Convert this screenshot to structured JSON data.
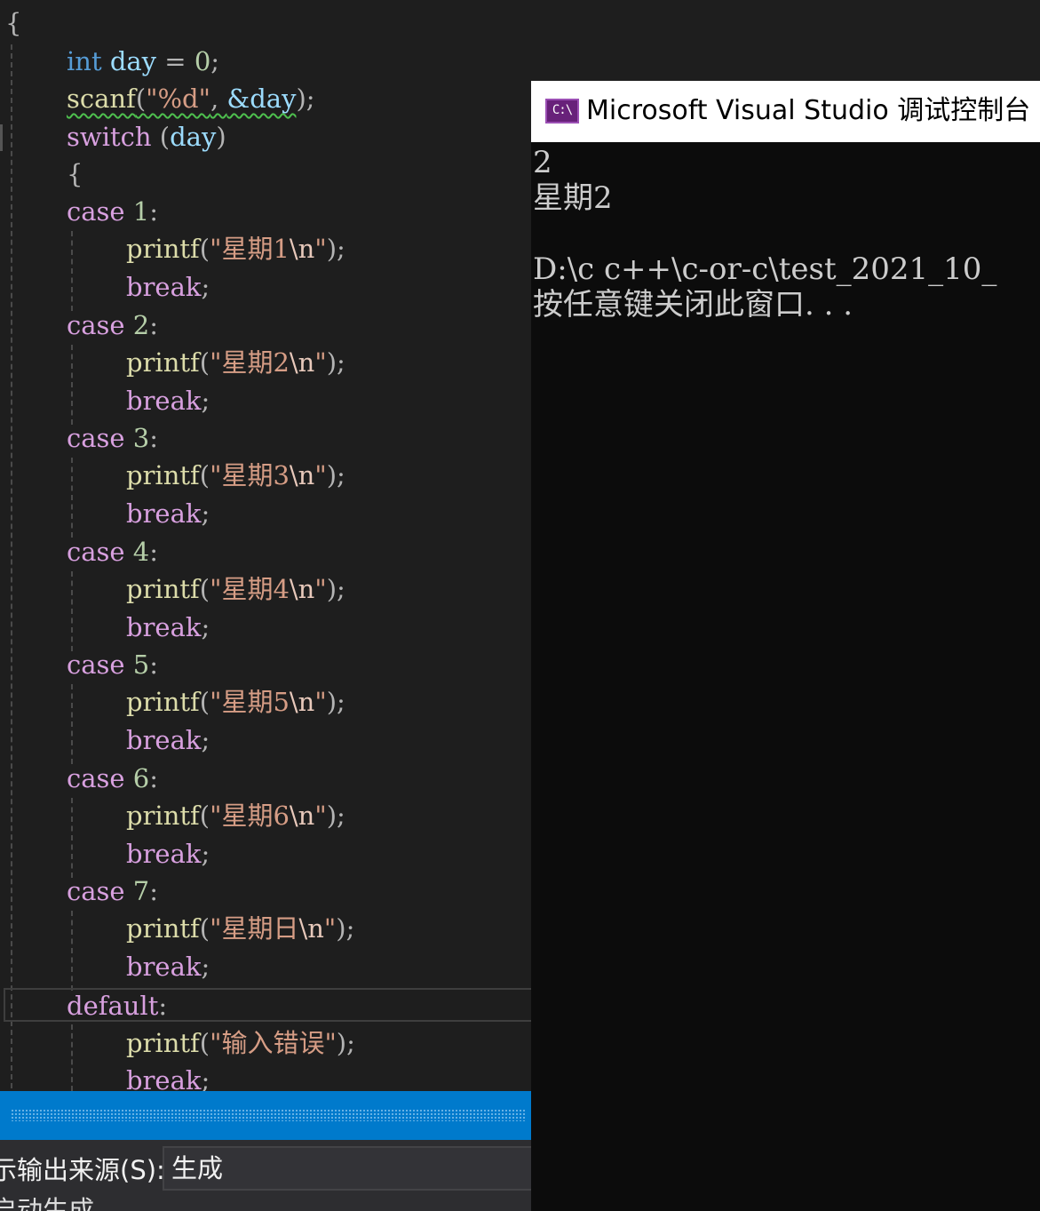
{
  "editor": {
    "open_brace": "{",
    "lines": {
      "decl": {
        "type": "int",
        "name": "day",
        "op": " = ",
        "value": "0",
        "end": ";"
      },
      "scanf": {
        "fn": "scanf",
        "open": "(",
        "fmt": "\"%d\"",
        "sep": ", ",
        "arg": "&day",
        "close": ");"
      },
      "switch": {
        "kw": "switch",
        "open": " (",
        "var": "day",
        "close": ")"
      },
      "brace": "{",
      "cases": [
        {
          "kw": "case",
          "num": "1",
          "colon": ":",
          "str_pre": "\"星期1",
          "esc": "\\n",
          "str_post": "\"",
          "brk": "break"
        },
        {
          "kw": "case",
          "num": "2",
          "colon": ":",
          "str_pre": "\"星期2",
          "esc": "\\n",
          "str_post": "\"",
          "brk": "break"
        },
        {
          "kw": "case",
          "num": "3",
          "colon": ":",
          "str_pre": "\"星期3",
          "esc": "\\n",
          "str_post": "\"",
          "brk": "break"
        },
        {
          "kw": "case",
          "num": "4",
          "colon": ":",
          "str_pre": "\"星期4",
          "esc": "\\n",
          "str_post": "\"",
          "brk": "break"
        },
        {
          "kw": "case",
          "num": "5",
          "colon": ":",
          "str_pre": "\"星期5",
          "esc": "\\n",
          "str_post": "\"",
          "brk": "break"
        },
        {
          "kw": "case",
          "num": "6",
          "colon": ":",
          "str_pre": "\"星期6",
          "esc": "\\n",
          "str_post": "\"",
          "brk": "break"
        },
        {
          "kw": "case",
          "num": "7",
          "colon": ":",
          "str_pre": "\"星期日",
          "esc": "\\n",
          "str_post": "\"",
          "brk": "break"
        }
      ],
      "default": {
        "kw": "default",
        "colon": ":",
        "fn": "printf",
        "str": "\"输入错误\"",
        "brk": "break"
      }
    },
    "printf": "printf",
    "paren_open": "(",
    "paren_close": ");",
    "semicolon": ";"
  },
  "output_panel": {
    "source_label": "示输出来源(S):",
    "source_value": "生成",
    "text": "启动生成…"
  },
  "console": {
    "icon_text": "C:\\",
    "title": "Microsoft Visual Studio 调试控制台",
    "lines": [
      "2",
      "星期2",
      "",
      "D:\\c c++\\c-or-c\\test_2021_10_",
      "按任意键关闭此窗口. . ."
    ]
  },
  "colors": {
    "keyword": "#569cd6",
    "control_keyword": "#d8a0df",
    "function": "#dcdcaa",
    "variable": "#9cdcfe",
    "string": "#d69d85",
    "number": "#b5cea8",
    "accent_blue": "#007acc",
    "console_bg": "#0c0c0c"
  }
}
